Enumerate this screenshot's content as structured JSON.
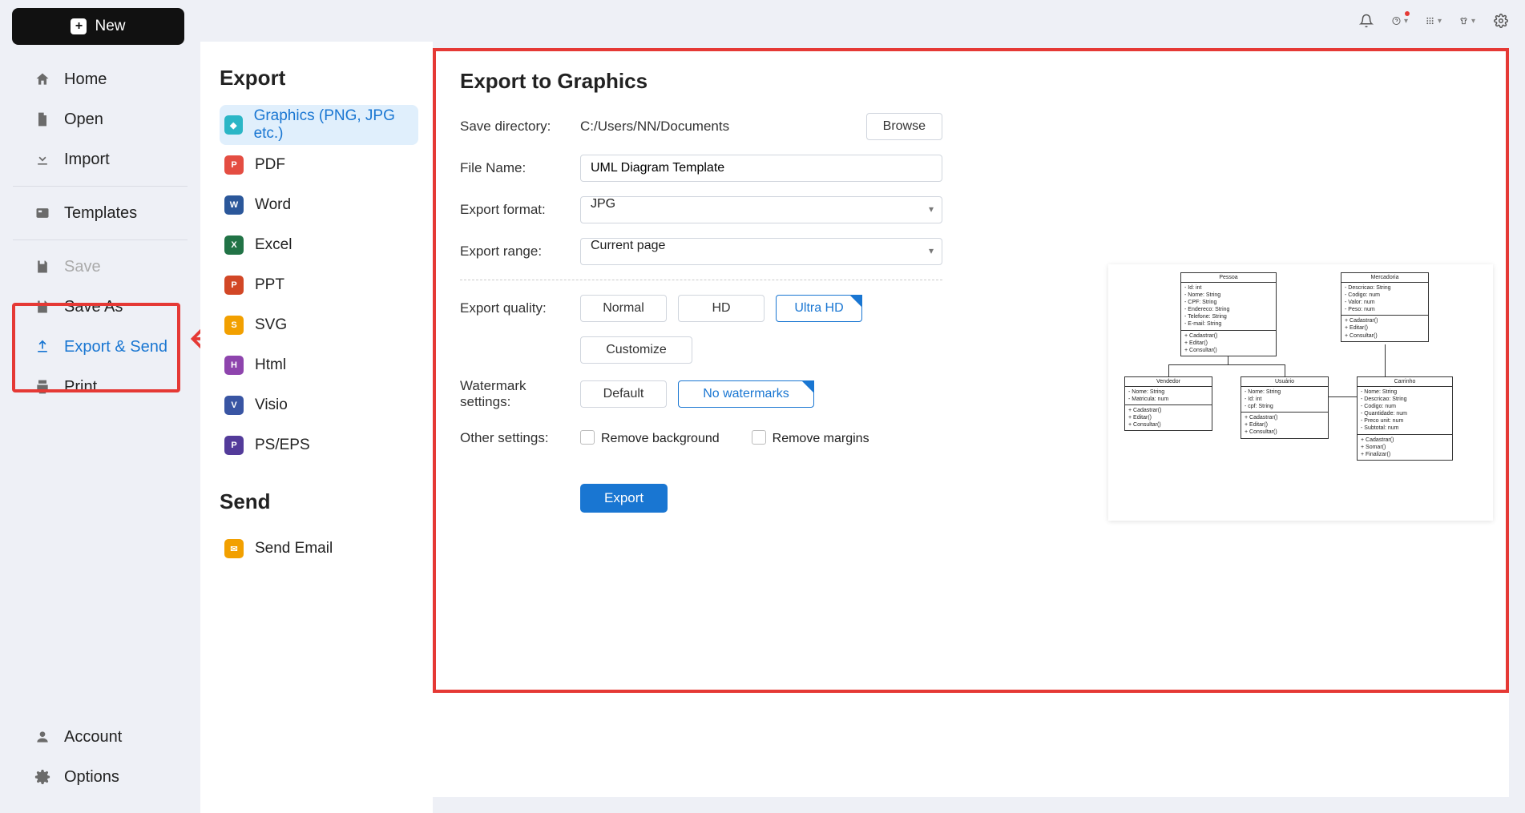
{
  "topbar": {
    "new": "New"
  },
  "sidebar": {
    "items": [
      {
        "label": "Home"
      },
      {
        "label": "Open"
      },
      {
        "label": "Import"
      },
      {
        "label": "Templates"
      },
      {
        "label": "Save"
      },
      {
        "label": "Save As"
      },
      {
        "label": "Export & Send"
      },
      {
        "label": "Print"
      }
    ],
    "bottom": [
      {
        "label": "Account"
      },
      {
        "label": "Options"
      }
    ]
  },
  "mid": {
    "export_heading": "Export",
    "formats": [
      {
        "label": "Graphics (PNG, JPG etc.)"
      },
      {
        "label": "PDF"
      },
      {
        "label": "Word"
      },
      {
        "label": "Excel"
      },
      {
        "label": "PPT"
      },
      {
        "label": "SVG"
      },
      {
        "label": "Html"
      },
      {
        "label": "Visio"
      },
      {
        "label": "PS/EPS"
      }
    ],
    "send_heading": "Send",
    "send_items": [
      {
        "label": "Send Email"
      }
    ]
  },
  "panel": {
    "title": "Export to Graphics",
    "labels": {
      "save_dir": "Save directory:",
      "file_name": "File Name:",
      "export_format": "Export format:",
      "export_range": "Export range:",
      "export_quality": "Export quality:",
      "watermark": "Watermark settings:",
      "other": "Other settings:"
    },
    "values": {
      "save_dir": "C:/Users/NN/Documents",
      "file_name": "UML Diagram Template",
      "export_format": "JPG",
      "export_range": "Current page"
    },
    "browse": "Browse",
    "quality": {
      "normal": "Normal",
      "hd": "HD",
      "ultra": "Ultra HD"
    },
    "customize": "Customize",
    "watermark": {
      "default": "Default",
      "none": "No watermarks"
    },
    "checks": {
      "remove_bg": "Remove background",
      "remove_margin": "Remove margins"
    },
    "export_btn": "Export"
  },
  "uml": {
    "boxes": [
      {
        "title": "Pessoa",
        "attrs": "- Id: int\n- Nome: String\n- CPF: String\n- Endereco: String\n- Telefone: String\n- E-mail: String",
        "ops": "+ Cadastrar()\n+ Editar()\n+ Consultar()"
      },
      {
        "title": "Mercadoria",
        "attrs": "- Descricao: String\n- Codigo: num\n- Valor: num\n- Peso: num",
        "ops": "+ Cadastrar()\n+ Editar()\n+ Consultar()"
      },
      {
        "title": "Vendedor",
        "attrs": "- Nome: String\n- Matricula: num",
        "ops": "+ Cadastrar()\n+ Editar()\n+ Consultar()"
      },
      {
        "title": "Usuário",
        "attrs": "- Nome: String\n- Id: int\n- cpf: String",
        "ops": "+ Cadastrar()\n+ Editar()\n+ Consultar()"
      },
      {
        "title": "Carrinho",
        "attrs": "- Nome: String\n- Descricao: String\n- Codigo: num\n- Quantidade: num\n- Preco unit: num\n- Subtotal: num",
        "ops": "+ Cadastrar()\n+ Somar()\n+ Finalizar()"
      }
    ]
  }
}
